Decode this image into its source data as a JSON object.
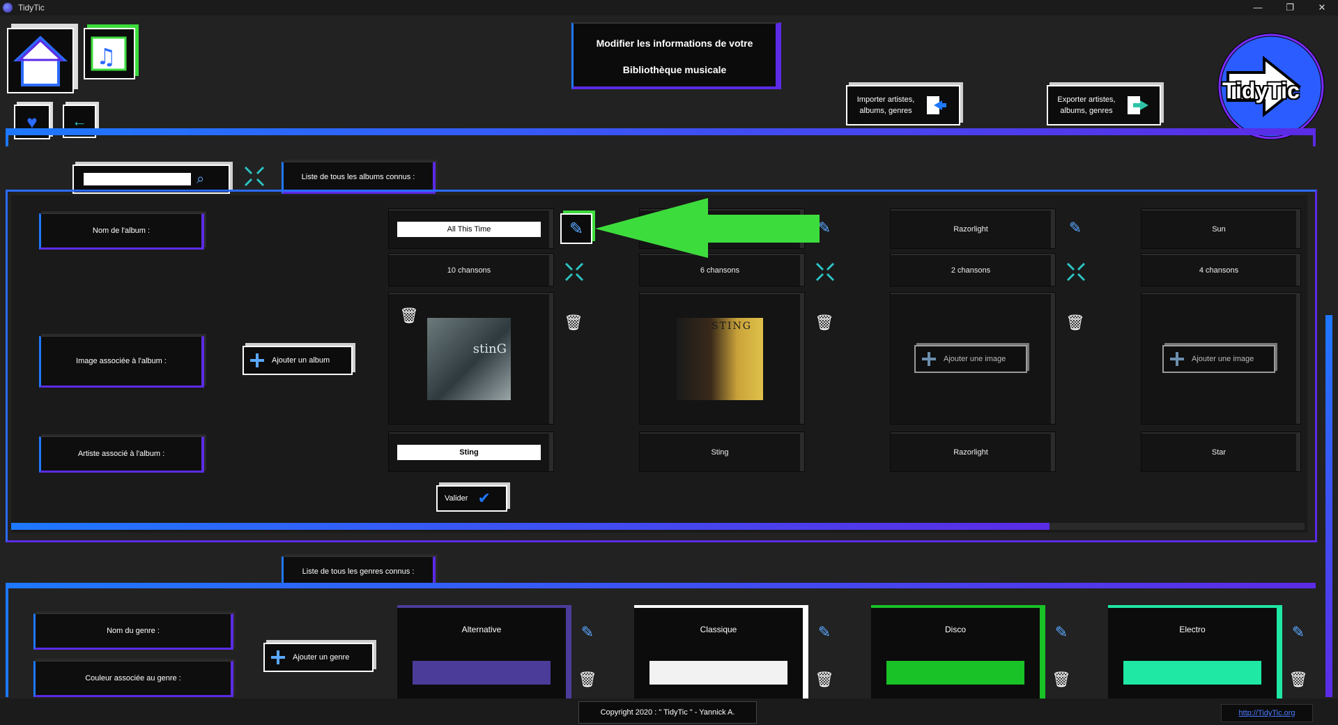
{
  "window": {
    "title": "TidyTic",
    "minimize": "—",
    "restore": "❐",
    "close": "✕"
  },
  "header": {
    "title_line1": "Modifier les informations de votre",
    "title_line2": "Bibliothèque musicale",
    "import_label": "Importer artistes, albums, genres",
    "export_label": "Exporter artistes, albums, genres",
    "logo_text": "TidyTic"
  },
  "albums_section": {
    "tab_label": "Liste de tous les albums connus :",
    "search": {
      "value": "",
      "placeholder": ""
    },
    "row_labels": {
      "name": "Nom de l'album :",
      "image": "Image associée à l'album :",
      "artist": "Artiste associé à l'album :"
    },
    "add_album_label": "Ajouter un album",
    "validate_label": "Valider",
    "add_image_label": "Ajouter une image",
    "albums": [
      {
        "name": "All This Time",
        "songs": "10 chansons",
        "artist": "Sting",
        "editing": true
      },
      {
        "name": "",
        "songs": "6 chansons",
        "artist": "Sting",
        "editing": false
      },
      {
        "name": "Razorlight",
        "songs": "2 chansons",
        "artist": "Razorlight",
        "editing": false
      },
      {
        "name": "Sun",
        "songs": "4 chansons",
        "artist": "Star",
        "editing": false
      }
    ],
    "cover_texts": {
      "album1": "stinG",
      "album2": "STING"
    }
  },
  "genres_section": {
    "tab_label": "Liste de tous les genres connus :",
    "row_labels": {
      "name": "Nom du genre :",
      "color": "Couleur associée au genre :"
    },
    "add_genre_label": "Ajouter un genre",
    "genres": [
      {
        "name": "Alternative",
        "color": "#4b3c9a",
        "border": "#4b3c9a"
      },
      {
        "name": "Classique",
        "color": "#f2f2f2",
        "border": "#ffffff"
      },
      {
        "name": "Disco",
        "color": "#19c226",
        "border": "#19c226"
      },
      {
        "name": "Electro",
        "color": "#1ee8a3",
        "border": "#1ee8a3"
      }
    ]
  },
  "footer": {
    "copyright": "Copyright 2020 : \" TidyTic \" - Yannick A.",
    "link": "http://TidyTic.org"
  },
  "colors": {
    "accent_blue": "#1e78ff",
    "accent_purple": "#5b2be6",
    "arrow_green": "#3ddc3d"
  }
}
